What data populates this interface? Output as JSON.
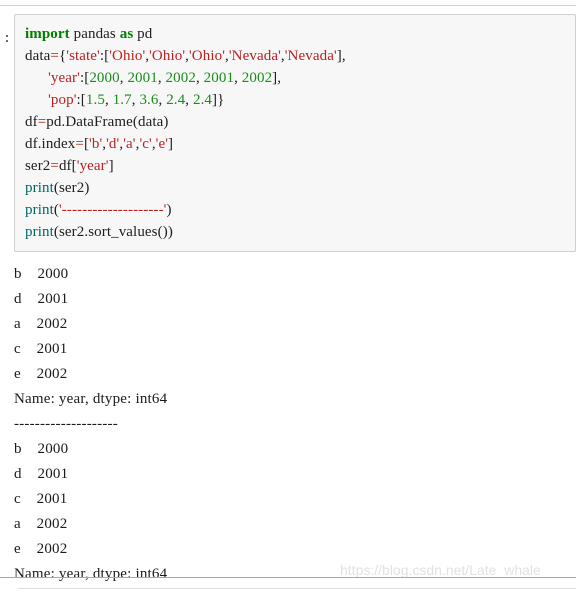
{
  "notebook": {
    "prompt_marker": ":",
    "watermark": "https://blog.csdn.net/Late_whale",
    "colors": {
      "cell_background": "#f7f7f7",
      "cell_border": "#cfcfcf",
      "keyword": "#008000",
      "builtin": "#006666",
      "string": "#ba2121",
      "number": "#1a8c1a",
      "operator": "#aa2211",
      "text": "#202020",
      "watermark": "#e2e2e2"
    }
  },
  "code": {
    "lines": [
      {
        "id": "line-1",
        "tokens": [
          {
            "t": "kw",
            "v": "import"
          },
          {
            "t": "plain",
            "v": " pandas "
          },
          {
            "t": "kw",
            "v": "as"
          },
          {
            "t": "plain",
            "v": " pd"
          }
        ]
      },
      {
        "id": "line-2",
        "tokens": [
          {
            "t": "plain",
            "v": "data"
          },
          {
            "t": "op",
            "v": "="
          },
          {
            "t": "punct",
            "v": "{"
          },
          {
            "t": "str",
            "v": "'state'"
          },
          {
            "t": "punct",
            "v": ":"
          },
          {
            "t": "punct",
            "v": "["
          },
          {
            "t": "str",
            "v": "'Ohio'"
          },
          {
            "t": "punct",
            "v": ","
          },
          {
            "t": "str",
            "v": "'Ohio'"
          },
          {
            "t": "punct",
            "v": ","
          },
          {
            "t": "str",
            "v": "'Ohio'"
          },
          {
            "t": "punct",
            "v": ","
          },
          {
            "t": "str",
            "v": "'Nevada'"
          },
          {
            "t": "punct",
            "v": ","
          },
          {
            "t": "str",
            "v": "'Nevada'"
          },
          {
            "t": "punct",
            "v": "],"
          }
        ]
      },
      {
        "id": "line-3",
        "tokens": [
          {
            "t": "plain",
            "v": "      "
          },
          {
            "t": "str",
            "v": "'year'"
          },
          {
            "t": "punct",
            "v": ":"
          },
          {
            "t": "punct",
            "v": "["
          },
          {
            "t": "num",
            "v": "2000"
          },
          {
            "t": "punct",
            "v": ", "
          },
          {
            "t": "num",
            "v": "2001"
          },
          {
            "t": "punct",
            "v": ", "
          },
          {
            "t": "num",
            "v": "2002"
          },
          {
            "t": "punct",
            "v": ", "
          },
          {
            "t": "num",
            "v": "2001"
          },
          {
            "t": "punct",
            "v": ", "
          },
          {
            "t": "num",
            "v": "2002"
          },
          {
            "t": "punct",
            "v": "],"
          }
        ]
      },
      {
        "id": "line-4",
        "tokens": [
          {
            "t": "plain",
            "v": "      "
          },
          {
            "t": "str",
            "v": "'pop'"
          },
          {
            "t": "punct",
            "v": ":"
          },
          {
            "t": "punct",
            "v": "["
          },
          {
            "t": "num",
            "v": "1.5"
          },
          {
            "t": "punct",
            "v": ", "
          },
          {
            "t": "num",
            "v": "1.7"
          },
          {
            "t": "punct",
            "v": ", "
          },
          {
            "t": "num",
            "v": "3.6"
          },
          {
            "t": "punct",
            "v": ", "
          },
          {
            "t": "num",
            "v": "2.4"
          },
          {
            "t": "punct",
            "v": ", "
          },
          {
            "t": "num",
            "v": "2.4"
          },
          {
            "t": "punct",
            "v": "]}"
          }
        ]
      },
      {
        "id": "line-5",
        "tokens": [
          {
            "t": "plain",
            "v": "df"
          },
          {
            "t": "op",
            "v": "="
          },
          {
            "t": "plain",
            "v": "pd.DataFrame"
          },
          {
            "t": "punct",
            "v": "("
          },
          {
            "t": "plain",
            "v": "data"
          },
          {
            "t": "punct",
            "v": ")"
          }
        ]
      },
      {
        "id": "line-6",
        "tokens": [
          {
            "t": "plain",
            "v": "df.index"
          },
          {
            "t": "op",
            "v": "="
          },
          {
            "t": "punct",
            "v": "["
          },
          {
            "t": "str",
            "v": "'b'"
          },
          {
            "t": "punct",
            "v": ","
          },
          {
            "t": "str",
            "v": "'d'"
          },
          {
            "t": "punct",
            "v": ","
          },
          {
            "t": "str",
            "v": "'a'"
          },
          {
            "t": "punct",
            "v": ","
          },
          {
            "t": "str",
            "v": "'c'"
          },
          {
            "t": "punct",
            "v": ","
          },
          {
            "t": "str",
            "v": "'e'"
          },
          {
            "t": "punct",
            "v": "]"
          }
        ]
      },
      {
        "id": "line-7",
        "tokens": [
          {
            "t": "plain",
            "v": "ser2"
          },
          {
            "t": "op",
            "v": "="
          },
          {
            "t": "plain",
            "v": "df"
          },
          {
            "t": "punct",
            "v": "["
          },
          {
            "t": "str",
            "v": "'year'"
          },
          {
            "t": "punct",
            "v": "]"
          }
        ]
      },
      {
        "id": "line-8",
        "tokens": [
          {
            "t": "builtin",
            "v": "print"
          },
          {
            "t": "punct",
            "v": "("
          },
          {
            "t": "plain",
            "v": "ser2"
          },
          {
            "t": "punct",
            "v": ")"
          }
        ]
      },
      {
        "id": "line-9",
        "tokens": [
          {
            "t": "builtin",
            "v": "print"
          },
          {
            "t": "punct",
            "v": "("
          },
          {
            "t": "str",
            "v": "'--------------------'"
          },
          {
            "t": "punct",
            "v": ")"
          }
        ]
      },
      {
        "id": "line-10",
        "tokens": [
          {
            "t": "builtin",
            "v": "print"
          },
          {
            "t": "punct",
            "v": "("
          },
          {
            "t": "plain",
            "v": "ser2.sort_values"
          },
          {
            "t": "punct",
            "v": "()"
          },
          {
            "t": "punct",
            "v": ")"
          }
        ]
      }
    ]
  },
  "output": {
    "lines": [
      "b    2000",
      "d    2001",
      "a    2002",
      "c    2001",
      "e    2002",
      "Name: year, dtype: int64",
      "--------------------",
      "b    2000",
      "d    2001",
      "c    2001",
      "a    2002",
      "e    2002",
      "Name: year, dtype: int64"
    ]
  }
}
